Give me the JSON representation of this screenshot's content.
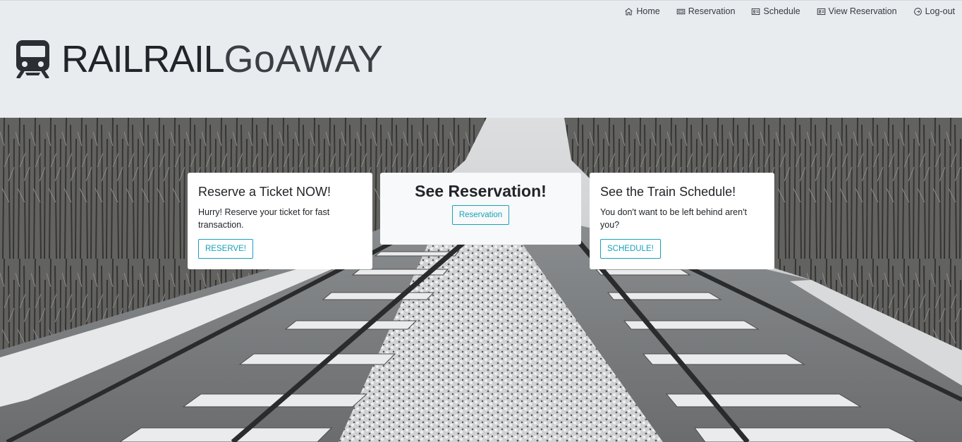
{
  "nav": {
    "items": [
      {
        "label": "Home",
        "icon": "home-icon"
      },
      {
        "label": "Reservation",
        "icon": "ticket-icon"
      },
      {
        "label": "Schedule",
        "icon": "id-card-icon"
      },
      {
        "label": "View Reservation",
        "icon": "id-card-icon"
      },
      {
        "label": "Log-out",
        "icon": "logout-icon"
      }
    ]
  },
  "brand": {
    "icon": "train-icon",
    "text_bold": "RAILRAIL",
    "text_light": "GoAWAY"
  },
  "hero": {
    "background": "snowy railroad tracks"
  },
  "cards": {
    "reserve": {
      "title": "Reserve a Ticket NOW!",
      "text": "Hurry! Reserve your ticket for fast transaction.",
      "button": "RESERVE!"
    },
    "see": {
      "title": "See Reservation!",
      "button": "Reservation"
    },
    "schedule": {
      "title": "See the Train Schedule!",
      "text": "You don't want to be left behind aren't you?",
      "button": "SCHEDULE!"
    }
  },
  "colors": {
    "header_bg": "#e9ecef",
    "accent": "#17a2b8",
    "text": "#212529"
  }
}
